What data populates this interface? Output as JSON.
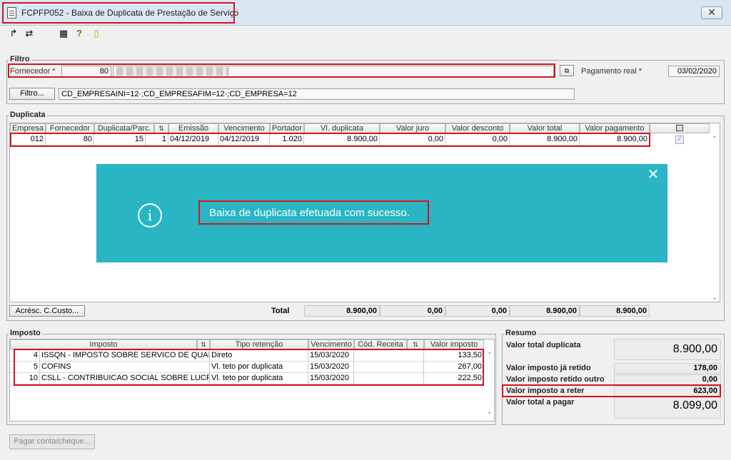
{
  "window": {
    "title": "FCPFP052 - Baixa de Duplicata de Prestação de Serviço",
    "close": "✕"
  },
  "toolbar": {
    "icons": [
      "↱",
      "⇄",
      "▦",
      "?",
      "▯"
    ]
  },
  "filtro": {
    "legend": "Filtro",
    "fornecedor_label": "Fornecedor *",
    "fornecedor_value": "80",
    "pagamento_label": "Pagamento real *",
    "pagamento_value": "03/02/2020",
    "filtro_button": "Filtro...",
    "filtro_value": "CD_EMPRESAINI=12·;CD_EMPRESAFIM=12·;CD_EMPRESA=12"
  },
  "duplicata": {
    "legend": "Duplicata",
    "columns": [
      "Empresa",
      "Fornecedor",
      "Duplicata/Parc.",
      "",
      "Emissão",
      "Vencimento",
      "Portador",
      "Vl. duplicata",
      "Valor juro",
      "Valor desconto",
      "Valor total",
      "Valor pagamento"
    ],
    "row": [
      "012",
      "80",
      "15",
      "1",
      "04/12/2019",
      "04/12/2019",
      "1.020",
      "8.900,00",
      "0,00",
      "0,00",
      "8.900,00",
      "8.900,00"
    ],
    "total_label": "Total",
    "totals": [
      "8.900,00",
      "0,00",
      "0,00",
      "8.900,00",
      "8.900,00"
    ],
    "acresc_button": "Acrésc. C.Custo..."
  },
  "toast": {
    "message": "Baixa de duplicata efetuada com sucesso.",
    "info": "i",
    "close": "✕"
  },
  "imposto": {
    "legend": "Imposto",
    "columns": [
      "Imposto",
      "Tipo retenção",
      "Vencimento",
      "Cód. Receita",
      "Valor imposto"
    ],
    "rows": [
      [
        "4",
        "ISSQN - IMPOSTO SOBRE SERVICO DE QUALQU",
        "Direto",
        "15/03/2020",
        "",
        "133,50"
      ],
      [
        "5",
        "COFINS",
        "Vl. teto por duplicata",
        "15/03/2020",
        "",
        "267,00"
      ],
      [
        "10",
        "CSLL - CONTRIBUICAO SOCIAL SOBRE LUCRO L",
        "Vl. teto por duplicata",
        "15/03/2020",
        "",
        "222,50"
      ]
    ]
  },
  "resumo": {
    "legend": "Resumo",
    "valor_total_duplicata_label": "Valor total duplicata",
    "valor_total_duplicata": "8.900,00",
    "ja_retido_label": "Valor imposto já retido",
    "ja_retido": "178,00",
    "retido_outro_label": "Valor imposto retido outro",
    "retido_outro": "0,00",
    "a_reter_label": "Valor imposto a reter",
    "a_reter": "623,00",
    "total_pagar_label": "Valor total a pagar",
    "total_pagar": "8.099,00"
  },
  "footer": {
    "pagar_button": "Pagar conta/cheque..."
  }
}
